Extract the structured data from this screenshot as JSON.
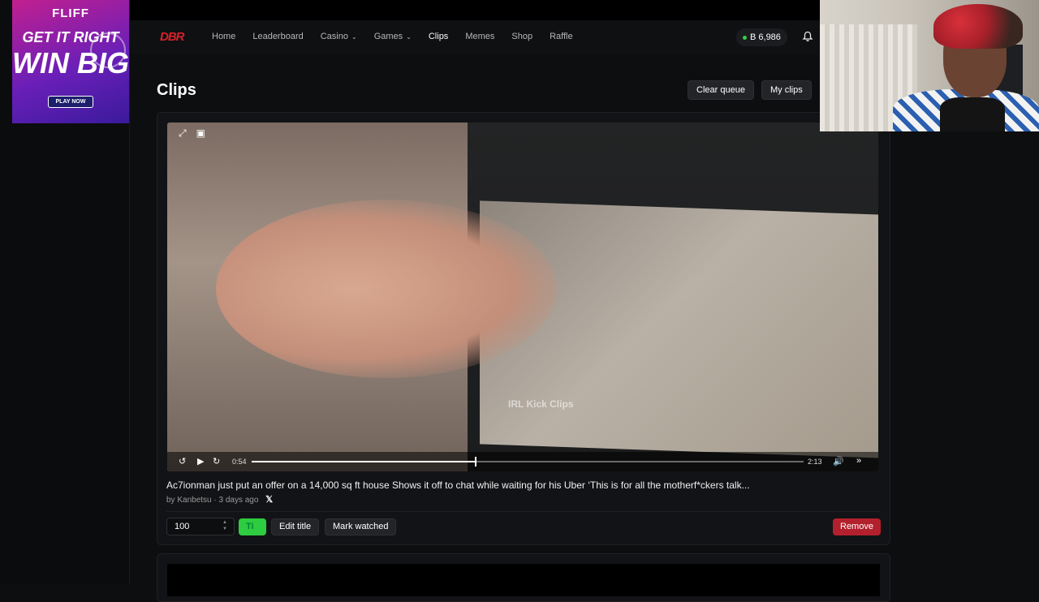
{
  "ad": {
    "brand": "FLIFF",
    "line1": "GET IT RIGHT",
    "line2": "WIN BIG",
    "cta": "PLAY NOW"
  },
  "nav": {
    "logo": "DBR",
    "links": [
      "Home",
      "Leaderboard",
      "Casino",
      "Games",
      "Clips",
      "Memes",
      "Shop",
      "Raffle"
    ],
    "active": "Clips",
    "balance": "B 6,986"
  },
  "page": {
    "title": "Clips",
    "clear_queue": "Clear queue",
    "my_clips": "My clips"
  },
  "player": {
    "current_time": "0:54",
    "duration": "2:13",
    "progress": 0.405,
    "watermark": "IRL Kick Clips"
  },
  "clip": {
    "title": "Ac7ionman just put an offer on a 14,000 sq ft house Shows it off to chat while waiting for his Uber ‘This is for all the motherf*ckers talk...",
    "author": "by Kanbetsu",
    "age": "· 3 days ago",
    "amount": "100",
    "tip_label": "Ti",
    "edit_title": "Edit title",
    "mark_watched": "Mark watched",
    "remove": "Remove"
  },
  "colors": {
    "accent_green": "#2ecc40",
    "danger": "#b3202d",
    "brand_red": "#d4222a"
  }
}
